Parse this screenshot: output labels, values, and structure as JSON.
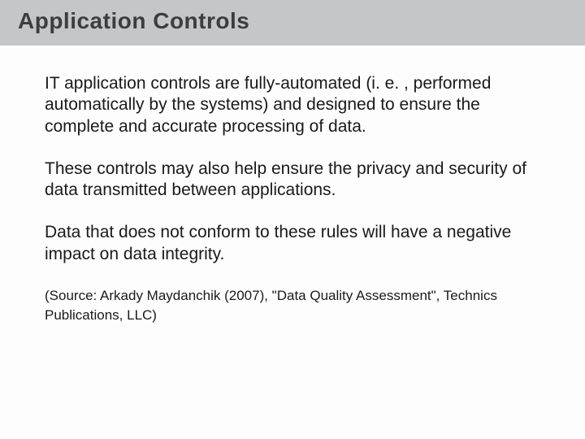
{
  "title": "Application Controls",
  "paragraphs": [
    "IT application controls are fully-automated (i. e. , performed automatically by the systems) and designed to ensure the complete and accurate processing of data.",
    "These controls may also help ensure the privacy and security of data transmitted between applications.",
    "Data that does not conform to these rules will have a negative impact on data integrity."
  ],
  "source": "(Source: Arkady Maydanchik (2007), \"Data Quality Assessment\", Technics Publications, LLC)"
}
